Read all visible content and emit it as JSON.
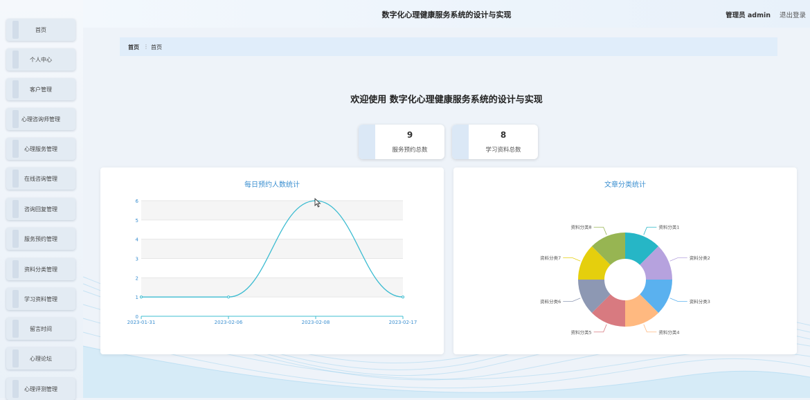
{
  "header": {
    "title": "数字化心理健康服务系统的设计与实现",
    "admin": "管理员 admin",
    "logout": "退出登录"
  },
  "sidebar": {
    "items": [
      {
        "label": "首页"
      },
      {
        "label": "个人中心"
      },
      {
        "label": "客户管理"
      },
      {
        "label": "心理咨询师管理"
      },
      {
        "label": "心理服务管理"
      },
      {
        "label": "在线咨询管理"
      },
      {
        "label": "咨询回复管理"
      },
      {
        "label": "服务预约管理"
      },
      {
        "label": "资料分类管理"
      },
      {
        "label": "学习资料管理"
      },
      {
        "label": "留言时间"
      },
      {
        "label": "心理论坛"
      },
      {
        "label": "心理评测管理"
      }
    ]
  },
  "breadcrumb": {
    "first": "首页",
    "sep": "⋮",
    "current": "首页"
  },
  "welcome": "欢迎使用 数字化心理健康服务系统的设计与实现",
  "stats": [
    {
      "value": "9",
      "label": "服务预约总数"
    },
    {
      "value": "8",
      "label": "学习资料总数"
    }
  ],
  "colors": {
    "line": "#3cbcd1",
    "accent": "#3b8fd0"
  },
  "chart_data": [
    {
      "type": "line",
      "title": "每日预约人数统计",
      "x": [
        "2023-01-31",
        "2023-02-06",
        "2023-02-08",
        "2023-02-17"
      ],
      "y": [
        1,
        1,
        6,
        1
      ],
      "ylim": [
        0,
        6
      ],
      "yticks": [
        0,
        1,
        2,
        3,
        4,
        5,
        6
      ],
      "smooth": true,
      "grid": true
    },
    {
      "type": "pie",
      "donut": true,
      "title": "文章分类统计",
      "labels": [
        "资料分类1",
        "资料分类2",
        "资料分类3",
        "资料分类4",
        "资料分类5",
        "资料分类6",
        "资料分类7",
        "资料分类8"
      ],
      "values": [
        1,
        1,
        1,
        1,
        1,
        1,
        1,
        1
      ],
      "colors": [
        "#26b6c6",
        "#b6a2de",
        "#5ab1ef",
        "#ffb980",
        "#d87a80",
        "#8d98b3",
        "#e5cf0d",
        "#97b552"
      ]
    }
  ]
}
